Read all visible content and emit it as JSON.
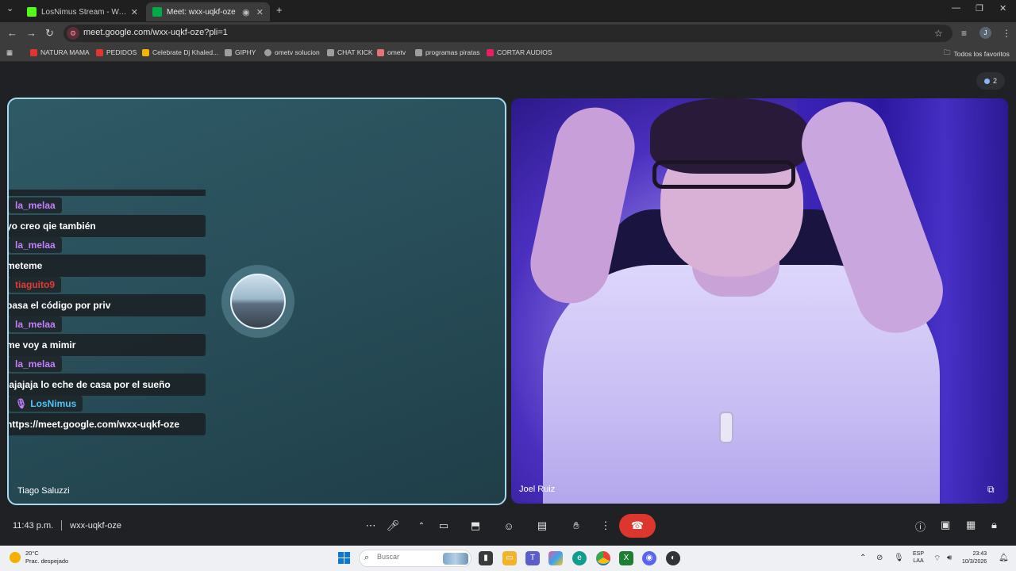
{
  "browser": {
    "tabs": [
      {
        "title": "LosNimus Stream - Watch Live",
        "active": false,
        "favicon_color": "#53fc18"
      },
      {
        "title": "Meet: wxx-uqkf-oze",
        "active": true,
        "favicon_color": "#00ac47"
      }
    ],
    "new_tab_label": "+",
    "url": "meet.google.com/wxx-uqkf-oze?pli=1",
    "profile_initial": "J",
    "bookmarks": [
      {
        "label": "NATURA MAMA",
        "color": "#e3342f"
      },
      {
        "label": "PEDIDOS",
        "color": "#e3342f"
      },
      {
        "label": "Celebrate Dj Khaled...",
        "color": "#f4b400"
      },
      {
        "label": "GIPHY",
        "color": "#9e9e9e"
      },
      {
        "label": "ometv solucion",
        "color": "#9e9e9e"
      },
      {
        "label": "CHAT KICK",
        "color": "#9e9e9e"
      },
      {
        "label": "ometv",
        "color": "#e57373"
      },
      {
        "label": "programas piratas",
        "color": "#9e9e9e"
      },
      {
        "label": "CORTAR AUDIOS",
        "color": "#e91e63"
      }
    ],
    "all_bookmarks_label": "Todos los favoritos"
  },
  "meet": {
    "participant_count": "2",
    "left_tile_name": "Tiago Saluzzi",
    "right_tile_name": "Joel Ruiz",
    "meeting_time": "11:43 p.m.",
    "meeting_code": "wxx-uqkf-oze"
  },
  "chat": [
    {
      "user": "la_melaa",
      "user_color": "#c77dff",
      "text": "yo creo qie también"
    },
    {
      "user": "la_melaa",
      "user_color": "#c77dff",
      "text": "meteme"
    },
    {
      "user": "tiaguito9",
      "user_color": "#e53935",
      "text": "pasa el código por priv"
    },
    {
      "user": "la_melaa",
      "user_color": "#c77dff",
      "text": "me voy a mimir"
    },
    {
      "user": "la_melaa",
      "user_color": "#c77dff",
      "text": "jajajaja lo eche de casa por el sueño"
    },
    {
      "user": "LosNimus",
      "user_color": "#4fc3f7",
      "text": "https://meet.google.com/wxx-uqkf-oze"
    }
  ],
  "taskbar": {
    "weather_temp": "20°C",
    "weather_desc": "Prac. despejado",
    "search_placeholder": "Buscar",
    "lang_line1": "ESP",
    "lang_line2": "LAA",
    "time": "23:43",
    "date": "10/3/2026"
  },
  "colors": {
    "accent_border": "#a8d8f0",
    "end_call": "#dc362e"
  }
}
